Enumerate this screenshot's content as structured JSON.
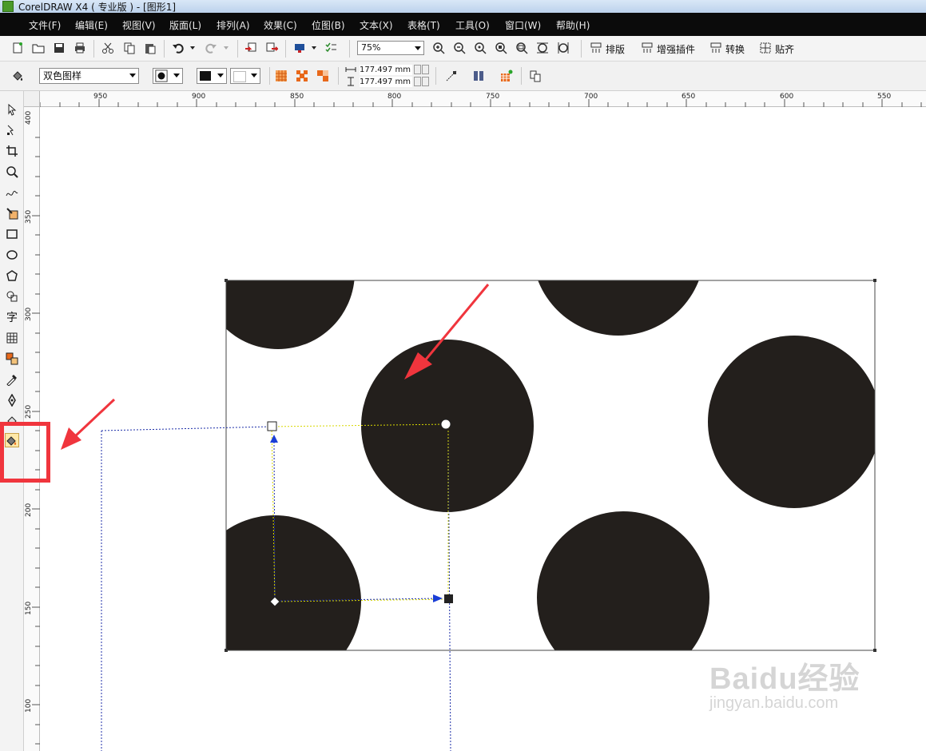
{
  "window": {
    "title": "CorelDRAW X4 ( 专业版 ) - [图形1]"
  },
  "menu": {
    "items": [
      "文件(F)",
      "编辑(E)",
      "视图(V)",
      "版面(L)",
      "排列(A)",
      "效果(C)",
      "位图(B)",
      "文本(X)",
      "表格(T)",
      "工具(O)",
      "窗口(W)",
      "帮助(H)"
    ]
  },
  "toolbar": {
    "zoom": "75%",
    "text_buttons": [
      "排版",
      "增强插件",
      "转换",
      "贴齐"
    ]
  },
  "property_bar": {
    "pattern_type": "双色图样",
    "width": "177.497 mm",
    "height": "177.497 mm"
  },
  "ruler": {
    "top_labels": [
      "950",
      "900",
      "850",
      "800",
      "750",
      "700",
      "650",
      "600",
      "550"
    ],
    "left_labels": [
      "400",
      "350",
      "300",
      "250",
      "200",
      "150",
      "100"
    ]
  },
  "toolbox": {
    "tools": [
      "pick-tool",
      "shape-tool",
      "crop-tool",
      "zoom-tool",
      "freehand-tool",
      "smart-fill-tool",
      "rectangle-tool",
      "ellipse-tool",
      "polygon-tool",
      "basic-shapes-tool",
      "text-tool",
      "table-tool",
      "interactive-blend-tool",
      "eyedropper-tool",
      "outline-pen-tool",
      "fill-tool",
      "interactive-fill-tool"
    ],
    "text_tool_glyph": "字"
  },
  "watermark": {
    "main": "Baidu经验",
    "sub": "jingyan.baidu.com"
  },
  "colors": {
    "circle_fill": "#231f1c",
    "annotation": "#f0353d",
    "menubar": "#0b0b0b"
  }
}
